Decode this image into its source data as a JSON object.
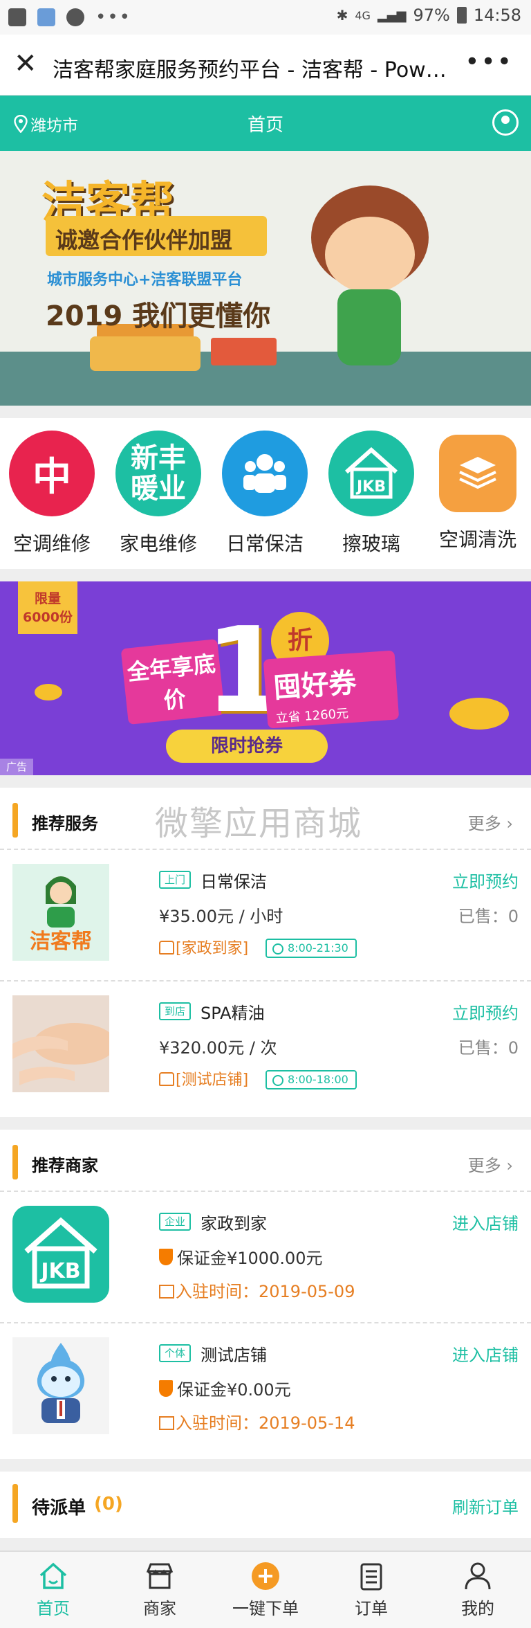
{
  "status_bar": {
    "battery": "97%",
    "time": "14:58",
    "signal": "4G"
  },
  "browser": {
    "title": "洁客帮家庭服务预约平台 - 洁客帮 - Pow…"
  },
  "header": {
    "city": "潍坊市",
    "title": "首页"
  },
  "banner": {
    "line1": "洁客帮",
    "line2": "诚邀合作伙伴加盟",
    "line3": "城市服务中心+洁客联盟平台",
    "line4": "2019 我们更懂你"
  },
  "categories": [
    {
      "label": "空调维修",
      "icon_text": "中",
      "color": "#e8234e",
      "icon": "brand-logo-icon"
    },
    {
      "label": "家电维修",
      "icon_text": "新丰暖业",
      "color": "#1dbfa3",
      "icon": "brand-logo-icon"
    },
    {
      "label": "日常保洁",
      "icon_text": "",
      "color": "#1f9ce0",
      "icon": "people-icon"
    },
    {
      "label": "擦玻璃",
      "icon_text": "JKB",
      "color": "#1dbfa3",
      "icon": "jkb-house-icon"
    },
    {
      "label": "空调清洗",
      "icon_text": "",
      "color": "#f5a040",
      "icon": "layers-icon"
    }
  ],
  "ad": {
    "badge_line1": "限量",
    "badge_line2": "6000份",
    "left_text": "全年享底价",
    "one": "1",
    "zhe": "折",
    "right_text": "囤好券",
    "right_sub": "立省 1260元",
    "button": "限时抢券",
    "tag": "广告"
  },
  "recommended_services": {
    "title": "推荐服务",
    "more": "更多",
    "watermark": "微擎应用商城",
    "items": [
      {
        "tag": "上门",
        "name": "日常保洁",
        "action": "立即预约",
        "price": "¥35.00元 / 小时",
        "sold": "已售：0",
        "shop": "[家政到家]",
        "hours": "8:00-21:30"
      },
      {
        "tag": "到店",
        "name": "SPA精油",
        "action": "立即预约",
        "price": "¥320.00元 / 次",
        "sold": "已售：0",
        "shop": "[测试店铺]",
        "hours": "8:00-18:00"
      }
    ]
  },
  "recommended_merchants": {
    "title": "推荐商家",
    "more": "更多",
    "items": [
      {
        "tag": "企业",
        "name": "家政到家",
        "action": "进入店铺",
        "deposit": "保证金¥1000.00元",
        "joined": "入驻时间：2019-05-09"
      },
      {
        "tag": "个体",
        "name": "测试店铺",
        "action": "进入店铺",
        "deposit": "保证金¥0.00元",
        "joined": "入驻时间：2019-05-14"
      }
    ]
  },
  "pending": {
    "title": "待派单",
    "count": "(0)",
    "refresh": "刷新订单"
  },
  "tabbar": [
    {
      "label": "首页",
      "icon": "home-icon",
      "active": true
    },
    {
      "label": "商家",
      "icon": "store-icon",
      "active": false
    },
    {
      "label": "一键下单",
      "icon": "plus-circle-icon",
      "active": false
    },
    {
      "label": "订单",
      "icon": "clipboard-icon",
      "active": false
    },
    {
      "label": "我的",
      "icon": "person-icon",
      "active": false
    }
  ],
  "colors": {
    "brand": "#1dbfa3",
    "accent": "#f5a623",
    "price_orange": "#e67e22"
  }
}
